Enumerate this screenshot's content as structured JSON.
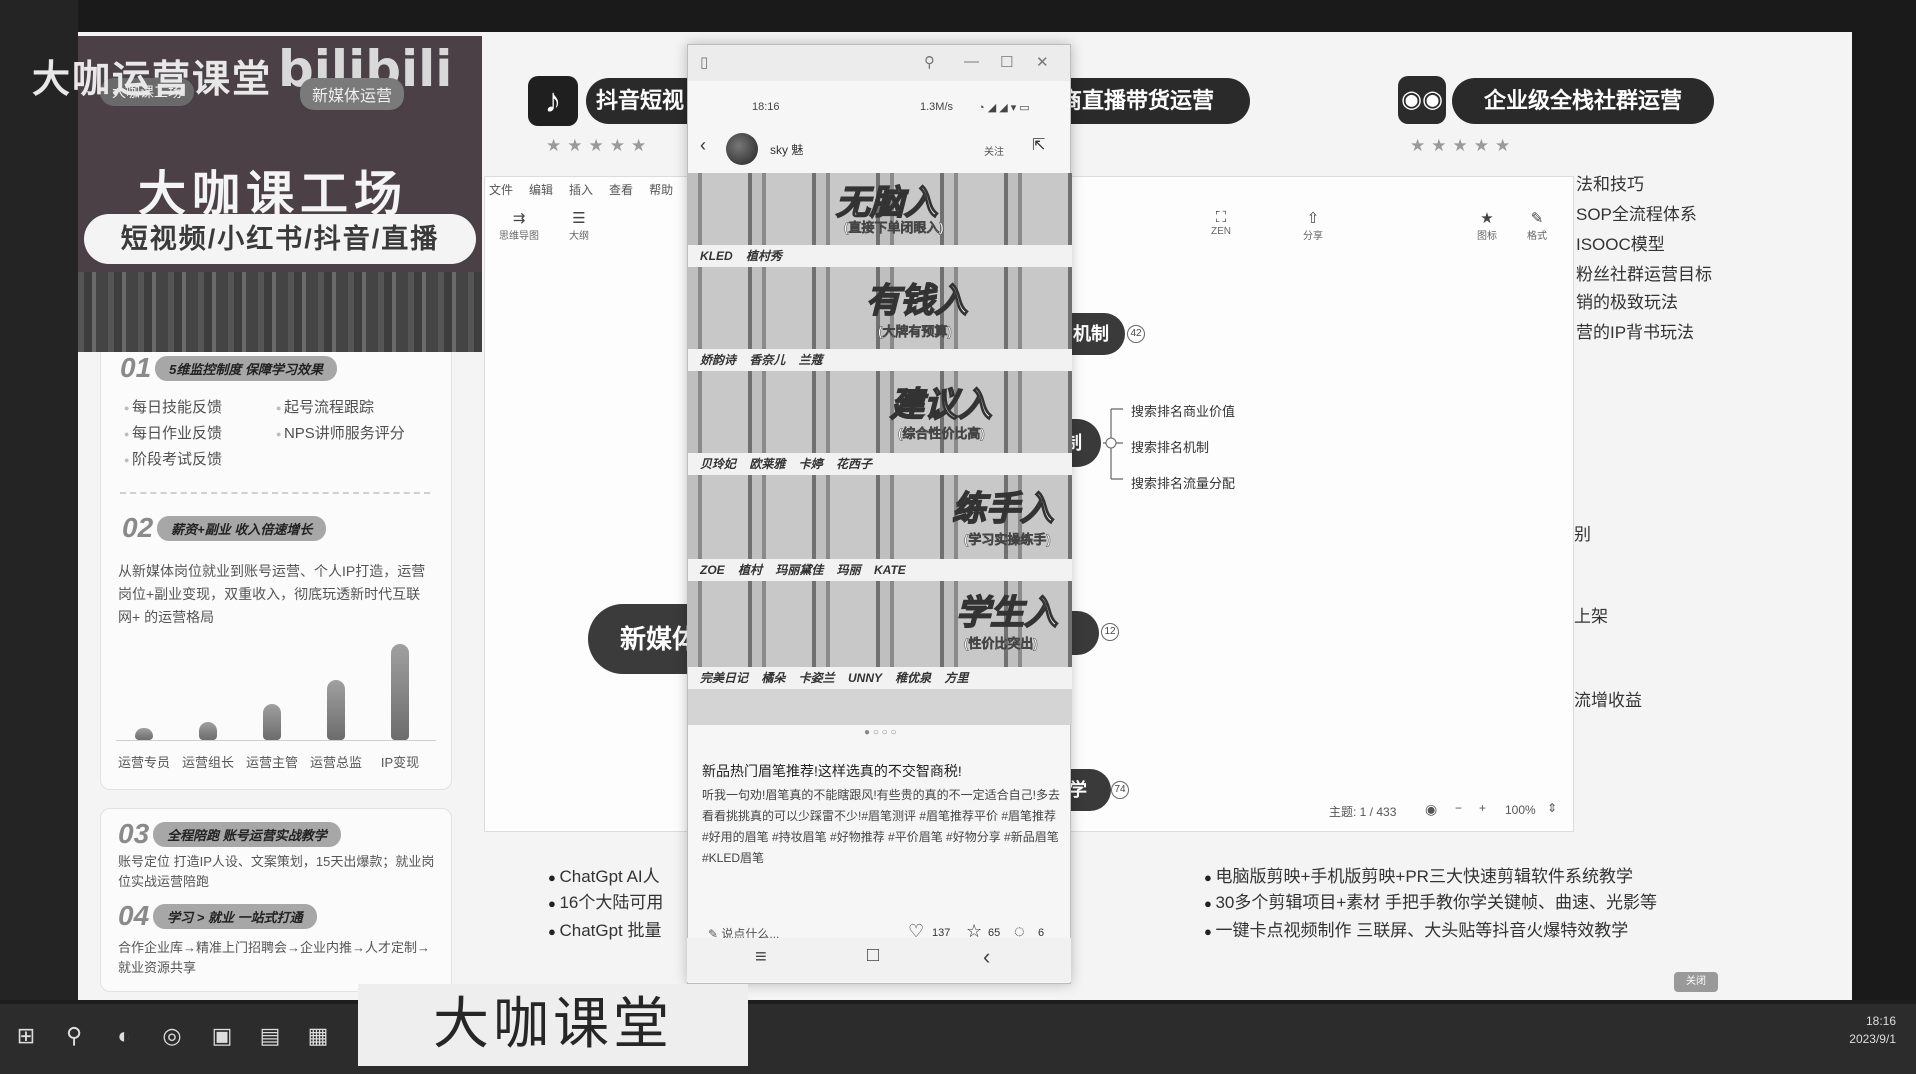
{
  "watermark_top": "大咖运营课堂",
  "watermark_bottom": "大咖课堂",
  "banner": {
    "brand_logo": "bilibili",
    "tag_left": "大咖课工场",
    "tag_right": "新媒体运营",
    "brand": "大咖课工场",
    "subtitle": "短视频/小红书/抖音/直播"
  },
  "left_card": {
    "sec1": {
      "num": "01",
      "title": "5维监控制度 保障学习效果"
    },
    "sec1_items": [
      "每日技能反馈",
      "起号流程跟踪",
      "每日作业反馈",
      "NPS讲师服务评分",
      "阶段考试反馈"
    ],
    "sec2": {
      "num": "02",
      "title": "薪资+副业 收入倍速增长"
    },
    "sec2_text": "从新媒体岗位就业到账号运营、个人IP打造，运营岗位+副业变现，双重收入，彻底玩透新时代互联网+ 的运营格局",
    "chart_labels": [
      "运营专员",
      "运营组长",
      "运营主管",
      "运营总监",
      "IP变现"
    ],
    "sec3": {
      "num": "03",
      "title": "全程陪跑 账号运营实战教学"
    },
    "sec3_text": "账号定位 打造IP人设、文案策划，15天出爆款；就业岗位实战运营陪跑",
    "sec4": {
      "num": "04",
      "title": "学习 > 就业 一站式打通"
    },
    "sec4_text": "合作企业库→精准上门招聘会→企业内推→人才定制→就业资源共享"
  },
  "chart_data": {
    "type": "bar",
    "categories": [
      "运营专员",
      "运营组长",
      "运营主管",
      "运营总监",
      "IP变现"
    ],
    "values": [
      1,
      1.5,
      3,
      5,
      8
    ]
  },
  "header": {
    "douyin_icon": "♪",
    "douyin_label": "抖音短视",
    "ecom_label": "商直播带货运营",
    "wechat_label": "企业级全栈社群运营",
    "stars": "★★★★★"
  },
  "right_list": [
    "法和技巧",
    "SOP全流程体系",
    "ISOOC模型",
    "粉丝社群运营目标",
    "销的极致玩法",
    "营的IP背书玩法"
  ],
  "mindmap": {
    "menu": [
      "文件",
      "编辑",
      "插入",
      "查看",
      "帮助"
    ],
    "tools_left": [
      {
        "glyph": "⇉",
        "label": "思维导图"
      },
      {
        "glyph": "☰",
        "label": "大纲"
      }
    ],
    "tools_right": [
      {
        "glyph": "⛶",
        "label": "ZEN"
      },
      {
        "glyph": "⇧",
        "label": "分享"
      },
      {
        "glyph": "★",
        "label": "图标"
      },
      {
        "glyph": "✎",
        "label": "格式"
      }
    ],
    "node1": "机制",
    "node1_count": "42",
    "node2": "制",
    "leaves": [
      "搜索排名商业价值",
      "搜索排名机制",
      "搜索排名流量分配"
    ],
    "node3_count": "12",
    "node4": "学",
    "node4_count": "74",
    "right_fragments": [
      "别",
      "上架",
      "流增收益"
    ],
    "status_topic": "主题: 1 / 433",
    "zoom": "100%"
  },
  "center_node": "新媒体",
  "bottom_left": [
    "ChatGpt AI人",
    "16个大陆可用",
    "ChatGpt 批量"
  ],
  "bottom_right": [
    "电脑版剪映+手机版剪映+PR三大快速剪辑软件系统教学",
    "30多个剪辑项目+素材 手把手教你学关键帧、曲速、光影等",
    "一键卡点视频制作 三联屏、大头贴等抖音火爆特效教学"
  ],
  "phone": {
    "time": "18:16",
    "net": "1.3M/s",
    "username": "sky 魅",
    "follow": "关注",
    "rows": [
      {
        "word": "无脑入",
        "sub": "(直接下单闭眼入)",
        "names": "KLED 植村秀"
      },
      {
        "word": "有钱入",
        "sub": "(大牌有预算)",
        "names": "娇韵诗 香奈儿 兰蔻"
      },
      {
        "word": "建议入",
        "sub": "(综合性价比高)",
        "names": "贝玲妃 欧莱雅 卡婷 花西子"
      },
      {
        "word": "练手入",
        "sub": "(学习实操练手)",
        "names": "ZOE 植村 玛丽黛佳 玛丽 KATE"
      },
      {
        "word": "学生入",
        "sub": "(性价比突出)",
        "names": "完美日记 橘朵 卡姿兰 UNNY 稚优泉 方里"
      }
    ],
    "post_title": "新品热门眉笔推荐!这样选真的不交智商税!",
    "post_body": "听我一句劝!眉笔真的不能瞎跟风!有些贵的真的不一定适合自己!多去看看挑挑真的可以少踩雷不少!#眉笔测评 #眉笔推荐平价 #眉笔推荐 #好用的眉笔 #持妆眉笔 #好物推荐 #平价眉笔 #好物分享 #新品眉笔 #KLED眉笔",
    "comment_placeholder": "说点什么...",
    "likes": "137",
    "stars": "65",
    "comments": "6"
  },
  "taskbar": {
    "time": "18:16",
    "date": "2023/9/1"
  },
  "mini_btn": "关闭"
}
